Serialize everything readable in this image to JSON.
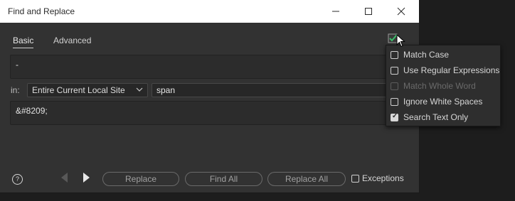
{
  "window": {
    "title": "Find and Replace"
  },
  "tabs": [
    {
      "label": "Basic",
      "active": true
    },
    {
      "label": "Advanced",
      "active": false
    }
  ],
  "find": {
    "value": "-"
  },
  "scope": {
    "in_label": "in:",
    "selected": "Entire Current Local Site",
    "tag_value": "span"
  },
  "replace": {
    "value": "&#8209;"
  },
  "footer": {
    "replace_label": "Replace",
    "find_all_label": "Find All",
    "replace_all_label": "Replace All",
    "exceptions_label": "Exceptions",
    "exceptions_checked": false
  },
  "options_menu": {
    "items": [
      {
        "label": "Match Case",
        "checked": false,
        "enabled": true
      },
      {
        "label": "Use Regular Expressions",
        "checked": false,
        "enabled": true
      },
      {
        "label": "Match Whole Word",
        "checked": false,
        "enabled": false
      },
      {
        "label": "Ignore White Spaces",
        "checked": false,
        "enabled": true
      },
      {
        "label": "Search Text Only",
        "checked": true,
        "enabled": true
      }
    ]
  },
  "colors": {
    "dialog_bg": "#323232",
    "titlebar_bg": "#ffffff",
    "accent_check": "#3bbd6a"
  }
}
